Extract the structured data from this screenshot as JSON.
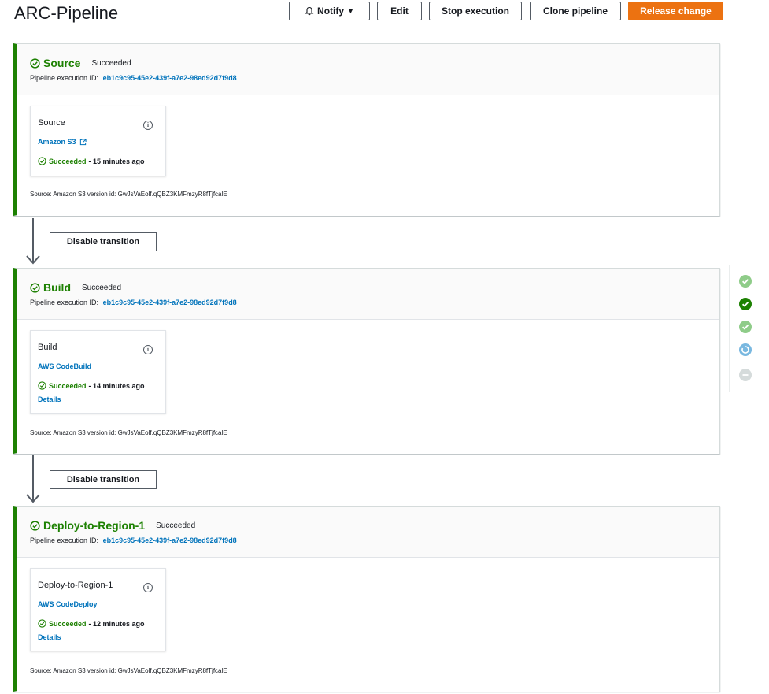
{
  "header": {
    "title": "ARC-Pipeline",
    "notify_label": "Notify",
    "edit_label": "Edit",
    "stop_label": "Stop execution",
    "clone_label": "Clone pipeline",
    "release_label": "Release change"
  },
  "colors": {
    "success": "#1d8102",
    "link": "#0073bb",
    "primary_button": "#ec7211",
    "in_progress": "#79b8e0",
    "inactive": "#d5dbdb"
  },
  "stages": [
    {
      "name": "Source",
      "status": "Succeeded",
      "exec_label": "Pipeline execution ID:",
      "exec_id": "eb1c9c95-45e2-439f-a7e2-98ed92d7f9d8",
      "action": {
        "name": "Source",
        "provider": "Amazon S3",
        "status": "Succeeded",
        "time": "- 15 minutes ago"
      },
      "version": "Source: Amazon S3 version id: GwJsVaEolf.qQBZ3KMFmzyR8fTjfcalE"
    },
    {
      "name": "Build",
      "status": "Succeeded",
      "exec_label": "Pipeline execution ID:",
      "exec_id": "eb1c9c95-45e2-439f-a7e2-98ed92d7f9d8",
      "action": {
        "name": "Build",
        "provider": "AWS CodeBuild",
        "status": "Succeeded",
        "time": "- 14 minutes ago",
        "details": "Details"
      },
      "version": "Source: Amazon S3 version id: GwJsVaEolf.qQBZ3KMFmzyR8fTjfcalE"
    },
    {
      "name": "Deploy-to-Region-1",
      "status": "Succeeded",
      "exec_label": "Pipeline execution ID:",
      "exec_id": "eb1c9c95-45e2-439f-a7e2-98ed92d7f9d8",
      "action": {
        "name": "Deploy-to-Region-1",
        "provider": "AWS CodeDeploy",
        "status": "Succeeded",
        "time": "- 12 minutes ago",
        "details": "Details"
      },
      "version": "Source: Amazon S3 version id: GwJsVaEolf.qQBZ3KMFmzyR8fTjfcalE"
    }
  ],
  "transitions": [
    {
      "label": "Disable transition"
    },
    {
      "label": "Disable transition"
    }
  ],
  "side_rail": {
    "dots": [
      "succeeded-light",
      "succeeded-current",
      "succeeded-light",
      "in-progress",
      "inactive"
    ]
  }
}
